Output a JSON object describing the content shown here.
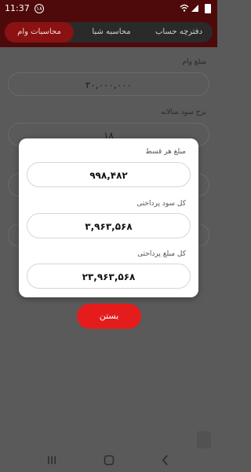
{
  "status_bar": {
    "time": "11:37",
    "notification_count": "۱۸"
  },
  "tabs": [
    {
      "label": "محاسبات وام",
      "active": true
    },
    {
      "label": "محاسبه شبا",
      "active": false
    },
    {
      "label": "دفترچه حساب",
      "active": false
    }
  ],
  "form": {
    "loan_amount_label": "مبلغ وام",
    "loan_amount_value": "۲۰,۰۰۰,۰۰۰",
    "interest_rate_label": "نرخ سود سالانه",
    "interest_rate_value": "۱۸"
  },
  "dialog": {
    "installment_label": "مبلغ هر قسط",
    "installment_value": "۹۹۸,۴۸۲",
    "total_interest_label": "کل سود پرداختی",
    "total_interest_value": "۳,۹۶۳,۵۶۸",
    "total_payment_label": "کل مبلغ پرداختی",
    "total_payment_value": "۲۳,۹۶۳,۵۶۸"
  },
  "close_button_label": "بستن",
  "nav": {
    "recents_icon": "recents-icon",
    "home_icon": "home-icon",
    "back_icon": "back-icon"
  },
  "colors": {
    "header": "#4e0a0a",
    "active_tab": "#8a1212",
    "close_button": "#e51c1c"
  }
}
